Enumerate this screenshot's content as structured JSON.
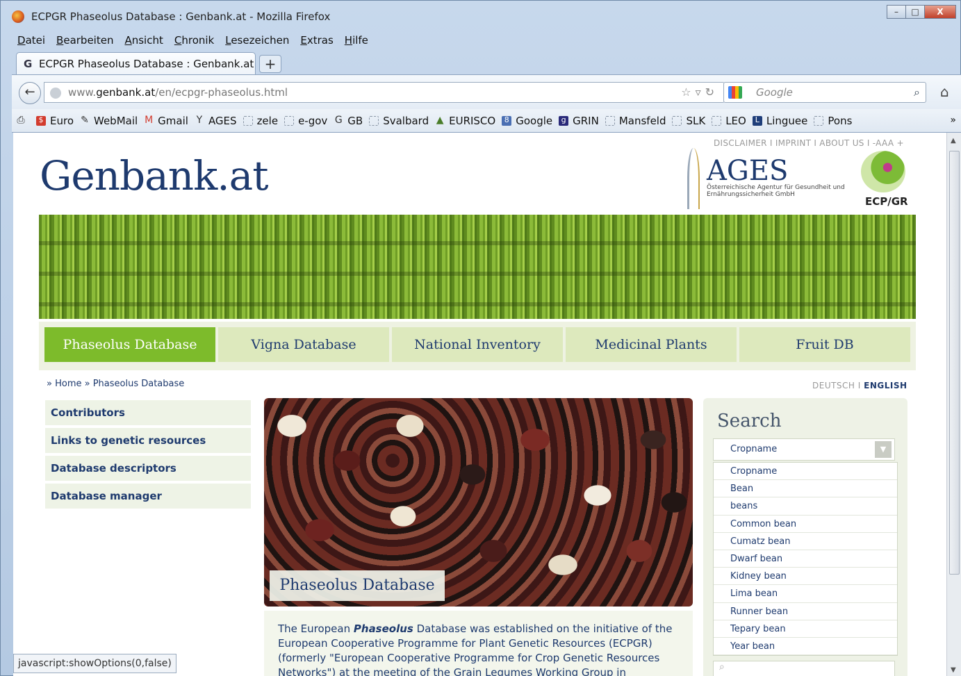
{
  "window": {
    "title": "ECPGR Phaseolus Database : Genbank.at - Mozilla Firefox",
    "minimize": "–",
    "maximize": "□",
    "close": "X"
  },
  "menu": [
    "Datei",
    "Bearbeiten",
    "Ansicht",
    "Chronik",
    "Lesezeichen",
    "Extras",
    "Hilfe"
  ],
  "tab": {
    "title": "ECPGR Phaseolus Database : Genbank.at",
    "new": "+"
  },
  "url": {
    "prefix": "www.",
    "domain": "genbank.at",
    "path": "/en/ecpgr-phaseolus.html"
  },
  "websearch": {
    "placeholder": "Google"
  },
  "bookmarks": [
    "Euro",
    "WebMail",
    "Gmail",
    "AGES",
    "zele",
    "e-gov",
    "GB",
    "Svalbard",
    "EURISCO",
    "Google",
    "GRIN",
    "Mansfeld",
    "SLK",
    "LEO",
    "Linguee",
    "Pons"
  ],
  "page": {
    "toplinks": "DISCLAIMER  I  IMPRINT  I  ABOUT US  I  -AAA +",
    "logo": "Genbank.at",
    "ages": {
      "name": "AGES",
      "sub": "Österreichische Agentur für Gesundheit und Ernährungssicherheit GmbH"
    },
    "ecpgr": "ECP/GR",
    "nav": [
      "Phaseolus Database",
      "Vigna Database",
      "National Inventory",
      "Medicinal Plants",
      "Fruit DB"
    ],
    "breadcrumb": "» Home » Phaseolus Database",
    "lang": {
      "de": "DEUTSCH",
      "sep": "I",
      "en": "ENGLISH"
    },
    "sidebar": [
      "Contributors",
      "Links to genetic resources",
      "Database descriptors",
      "Database manager"
    ],
    "hero_caption": "Phaseolus Database",
    "intro": {
      "pre": "The European ",
      "em": "Phaseolus",
      "post": " Database was established on the initiative of the European Cooperative Programme for Plant Genetic Resources (ECPGR) (formerly \"European Cooperative Programme for Crop Genetic Resources Networks\") at the meeting of the Grain Legumes Working Group in"
    },
    "search": {
      "title": "Search",
      "selected": "Cropname",
      "options": [
        "Cropname",
        "Bean",
        "beans",
        "Common bean",
        "Cumatz bean",
        "Dwarf bean",
        "Kidney bean",
        "Lima bean",
        "Runner bean",
        "Tepary bean",
        "Year bean"
      ]
    }
  },
  "status": "javascript:showOptions(0,false)"
}
